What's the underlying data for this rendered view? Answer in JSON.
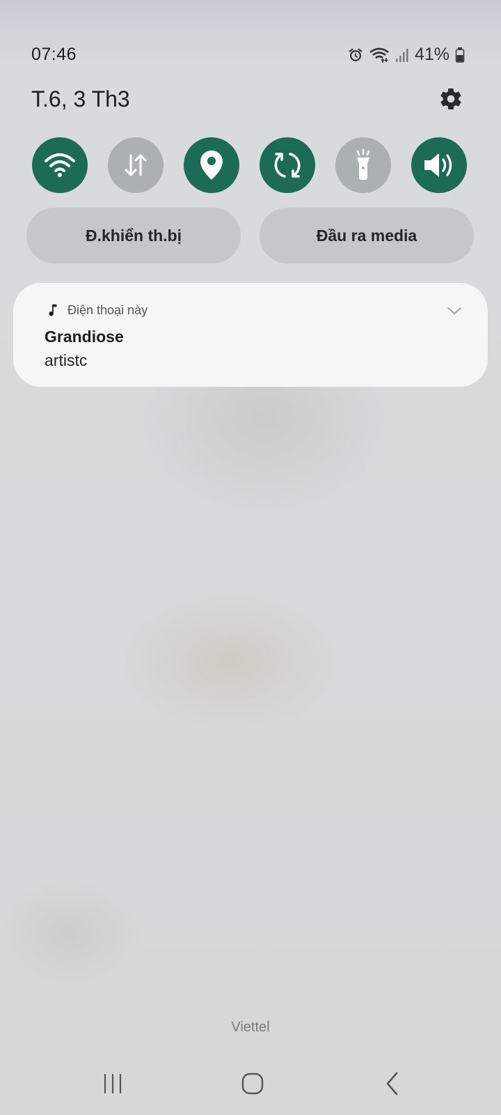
{
  "status_bar": {
    "time": "07:46",
    "battery_percent": "41%",
    "icons": [
      "alarm-icon",
      "wifi-icon",
      "signal-icon",
      "battery-icon"
    ]
  },
  "header": {
    "date": "T.6, 3 Th3",
    "settings_icon": "gear-icon"
  },
  "quick_tiles": [
    {
      "icon": "wifi-icon",
      "state": "on"
    },
    {
      "icon": "mobile-data-icon",
      "state": "off"
    },
    {
      "icon": "location-icon",
      "state": "on"
    },
    {
      "icon": "auto-rotate-icon",
      "state": "on"
    },
    {
      "icon": "flashlight-icon",
      "state": "off"
    },
    {
      "icon": "sound-icon",
      "state": "on"
    }
  ],
  "pills": {
    "device_control": "Đ.khiển th.bị",
    "media_output": "Đầu ra media"
  },
  "media_card": {
    "source": "Điện thoại này",
    "title": "Grandiose",
    "artist": "artistc"
  },
  "carrier": "Viettel",
  "nav": [
    "recents-icon",
    "home-icon",
    "back-icon"
  ],
  "colors": {
    "tile_on": "#1b6b57",
    "tile_off": "#abb0b0"
  }
}
